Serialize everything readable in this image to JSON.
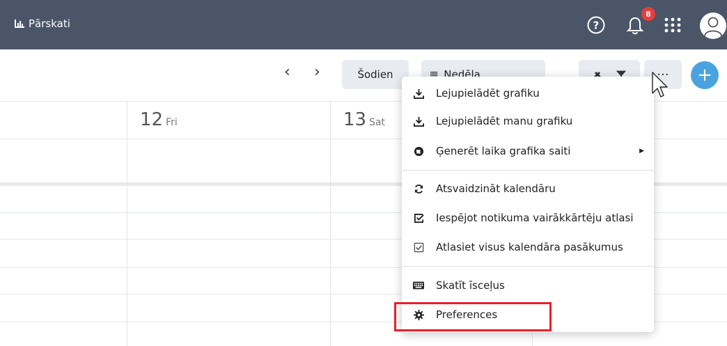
{
  "topbar": {
    "brand": "Pārskati",
    "notification_count": "8",
    "bg": "#4a5568"
  },
  "toolbar": {
    "today_label": "Šodien",
    "view_select": "Nedēļa"
  },
  "calendar": {
    "days": [
      {
        "num": "12",
        "name": "Fri"
      },
      {
        "num": "13",
        "name": "Sat"
      }
    ]
  },
  "menu": {
    "items": [
      {
        "label": "Lejupielādēt grafiku",
        "icon": "download-icon"
      },
      {
        "label": "Lejupielādēt manu grafiku",
        "icon": "download-icon"
      },
      {
        "label": "Ģenerēt laika grafika saiti",
        "icon": "globe-icon",
        "submenu": true
      },
      {
        "label": "Atsvaidzināt kalendāru",
        "icon": "refresh-icon"
      },
      {
        "label": "Iespējot notikuma vairākkārtēju atlasi",
        "icon": "multi-select-icon"
      },
      {
        "label": "Atlasiet visus kalendāra pasākumus",
        "icon": "checkbox-icon"
      },
      {
        "label": "Skatīt īsceļus",
        "icon": "keyboard-icon"
      },
      {
        "label": "Preferences",
        "icon": "gear-icon"
      }
    ]
  },
  "colors": {
    "accent": "#4aa3df",
    "badge": "#e53e3e",
    "highlight": "#e8202a"
  }
}
